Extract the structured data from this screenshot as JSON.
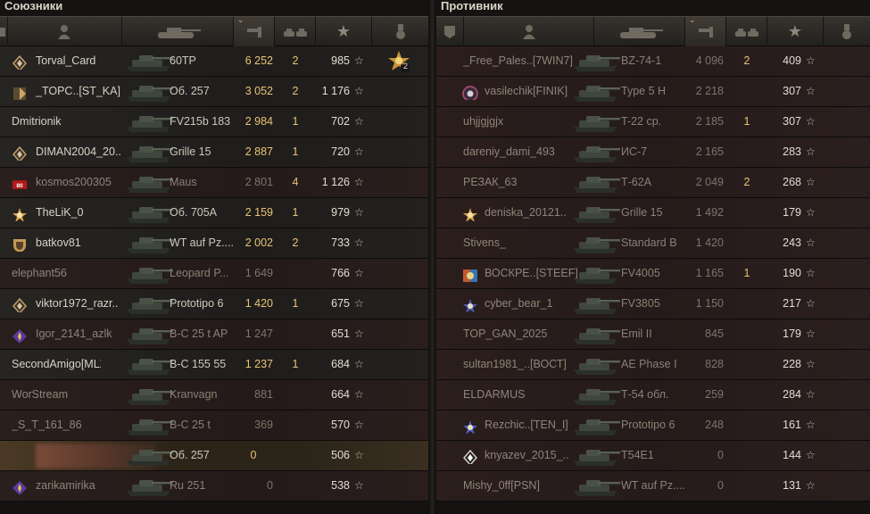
{
  "allies": {
    "title": "Союзники",
    "rows": [
      {
        "name": "Torval_Card",
        "badge": "diamond",
        "vehicle": "60TP",
        "damage": "6 252",
        "kills": "2",
        "xp": "985",
        "medal": "2",
        "dead": false
      },
      {
        "name": "_TOPC..[ST_KA]",
        "badge": "clan",
        "vehicle": "Об. 257",
        "damage": "3 052",
        "kills": "2",
        "xp": "1 176",
        "dead": false
      },
      {
        "name": "Dmitrionik",
        "badge": "",
        "vehicle": "FV215b 183",
        "damage": "2 984",
        "kills": "1",
        "xp": "702",
        "dead": false
      },
      {
        "name": "DIMAN2004_20..",
        "badge": "diamond",
        "vehicle": "Grille 15",
        "damage": "2 887",
        "kills": "1",
        "xp": "720",
        "dead": false
      },
      {
        "name": "kosmos200305",
        "badge": "red",
        "vehicle": "Maus",
        "damage": "2 801",
        "kills": "4",
        "xp": "1 126",
        "dead": true
      },
      {
        "name": "TheLiK_0",
        "badge": "star",
        "vehicle": "Об. 705А",
        "damage": "2 159",
        "kills": "1",
        "xp": "979",
        "dead": false
      },
      {
        "name": "batkov81",
        "badge": "shield",
        "vehicle": "WT auf Pz....",
        "damage": "2 002",
        "kills": "2",
        "xp": "733",
        "dead": false
      },
      {
        "name": "elephant56",
        "badge": "",
        "vehicle": "Leopard P...",
        "damage": "1 649",
        "kills": "",
        "xp": "766",
        "dead": true
      },
      {
        "name": "viktor1972_razr..",
        "badge": "diamond",
        "vehicle": "Prototipo 6",
        "damage": "1 420",
        "kills": "1",
        "xp": "675",
        "dead": false
      },
      {
        "name": "Igor_2141_azlk",
        "badge": "purple",
        "vehicle": "В-С 25 t AP",
        "damage": "1 247",
        "kills": "",
        "xp": "651",
        "dead": true
      },
      {
        "name": "SecondAmigo[MLX]",
        "badge": "",
        "vehicle": "В-С 155 55",
        "damage": "1 237",
        "kills": "1",
        "xp": "684",
        "dead": false
      },
      {
        "name": "WorStream",
        "badge": "",
        "vehicle": "Kranvagn",
        "damage": "881",
        "kills": "",
        "xp": "664",
        "dead": true
      },
      {
        "name": "_S_T_161_86",
        "badge": "",
        "vehicle": "В-С 25 t",
        "damage": "369",
        "kills": "",
        "xp": "570",
        "dead": true
      },
      {
        "name": "",
        "badge": "",
        "vehicle": "Об. 257",
        "damage": "0",
        "kills": "",
        "xp": "506",
        "dead": false,
        "player": true
      },
      {
        "name": "zarikamirika",
        "badge": "purple",
        "vehicle": "Ru 251",
        "damage": "0",
        "kills": "",
        "xp": "538",
        "dead": true
      }
    ]
  },
  "enemies": {
    "title": "Противник",
    "rows": [
      {
        "name": "_Free_Pales..[7WIN7]",
        "badge": "",
        "vehicle": "BZ-74-1",
        "damage": "4 096",
        "kills": "2",
        "xp": "409",
        "dead": true
      },
      {
        "name": "vasilechik[FINIK]",
        "badge": "clanred",
        "vehicle": "Type 5 H",
        "damage": "2 218",
        "kills": "",
        "xp": "307",
        "dead": true
      },
      {
        "name": "uhjjgjgjx",
        "badge": "",
        "vehicle": "T-22 ср.",
        "damage": "2 185",
        "kills": "1",
        "xp": "307",
        "dead": true
      },
      {
        "name": "dareniy_dami_493",
        "badge": "",
        "vehicle": "ИС-7",
        "damage": "2 165",
        "kills": "",
        "xp": "283",
        "dead": true
      },
      {
        "name": "РЕЗАК_63",
        "badge": "",
        "vehicle": "Т-62А",
        "damage": "2 049",
        "kills": "2",
        "xp": "268",
        "dead": true
      },
      {
        "name": "deniska_20121..",
        "badge": "star",
        "vehicle": "Grille 15",
        "damage": "1 492",
        "kills": "",
        "xp": "179",
        "dead": true
      },
      {
        "name": "Stivens_",
        "badge": "",
        "vehicle": "Standard B",
        "damage": "1 420",
        "kills": "",
        "xp": "243",
        "dead": true
      },
      {
        "name": "ВОСКРЕ..[STEEF]",
        "badge": "clanmulti",
        "vehicle": "FV4005",
        "damage": "1 165",
        "kills": "1",
        "xp": "190",
        "dead": true
      },
      {
        "name": "cyber_bear_1",
        "badge": "starblue",
        "vehicle": "FV3805",
        "damage": "1 150",
        "kills": "",
        "xp": "217",
        "dead": true
      },
      {
        "name": "TOP_GAN_2025",
        "badge": "",
        "vehicle": "Emil II",
        "damage": "845",
        "kills": "",
        "xp": "179",
        "dead": true
      },
      {
        "name": "sultan1981_..[ВОСТ]",
        "badge": "",
        "vehicle": "AE Phase I",
        "damage": "828",
        "kills": "",
        "xp": "228",
        "dead": true
      },
      {
        "name": "ELDARMUS",
        "badge": "",
        "vehicle": "Т-54 обл.",
        "damage": "259",
        "kills": "",
        "xp": "284",
        "dead": true
      },
      {
        "name": "Rezchic..[TEN_I]",
        "badge": "starblue",
        "vehicle": "Prototipo 6",
        "damage": "248",
        "kills": "",
        "xp": "161",
        "dead": true
      },
      {
        "name": "knyazev_2015_..",
        "badge": "diamondw",
        "vehicle": "T54E1",
        "damage": "0",
        "kills": "",
        "xp": "144",
        "dead": true
      },
      {
        "name": "Mishy_0ff[PSN]",
        "badge": "",
        "vehicle": "WT auf Pz....",
        "damage": "0",
        "kills": "",
        "xp": "131",
        "dead": true
      }
    ]
  },
  "colors": {
    "damage_alive": "#e8c374",
    "text": "#d6d2c6",
    "dead_text": "#8f8578"
  },
  "star_glyph": "☆"
}
